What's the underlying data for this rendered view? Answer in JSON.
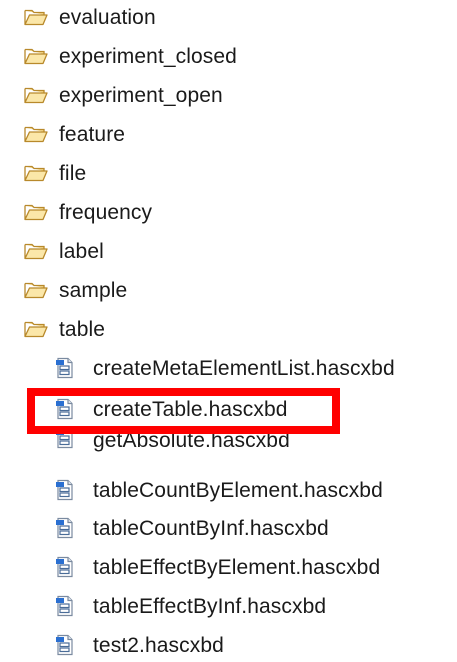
{
  "folders": [
    {
      "label": "evaluation",
      "icon": "folder-open-icon"
    },
    {
      "label": "experiment_closed",
      "icon": "folder-open-icon"
    },
    {
      "label": "experiment_open",
      "icon": "folder-open-icon"
    },
    {
      "label": "feature",
      "icon": "folder-open-icon"
    },
    {
      "label": "file",
      "icon": "folder-open-icon"
    },
    {
      "label": "frequency",
      "icon": "folder-open-icon"
    },
    {
      "label": "label",
      "icon": "folder-open-icon"
    },
    {
      "label": "sample",
      "icon": "folder-open-icon"
    },
    {
      "label": "table",
      "icon": "folder-open-icon"
    }
  ],
  "files": [
    {
      "label": "createMetaElementList.hascxbd",
      "icon": "hascxbd-file-icon"
    },
    {
      "label": "createTable.hascxbd",
      "icon": "hascxbd-file-icon"
    },
    {
      "label": "getAbsolute.hascxbd",
      "icon": "hascxbd-file-icon"
    },
    {
      "label": "tableCountByElement.hascxbd",
      "icon": "hascxbd-file-icon"
    },
    {
      "label": "tableCountByInf.hascxbd",
      "icon": "hascxbd-file-icon"
    },
    {
      "label": "tableEffectByElement.hascxbd",
      "icon": "hascxbd-file-icon"
    },
    {
      "label": "tableEffectByInf.hascxbd",
      "icon": "hascxbd-file-icon"
    },
    {
      "label": "test2.hascxbd",
      "icon": "hascxbd-file-icon"
    }
  ],
  "highlight": {
    "target": "createTable.hascxbd",
    "color": "#ff0000"
  },
  "colors": {
    "folder_fill": "#f5d98a",
    "folder_stroke": "#b8892b",
    "file_blue": "#2a6fd1",
    "file_paper": "#ffffff"
  }
}
